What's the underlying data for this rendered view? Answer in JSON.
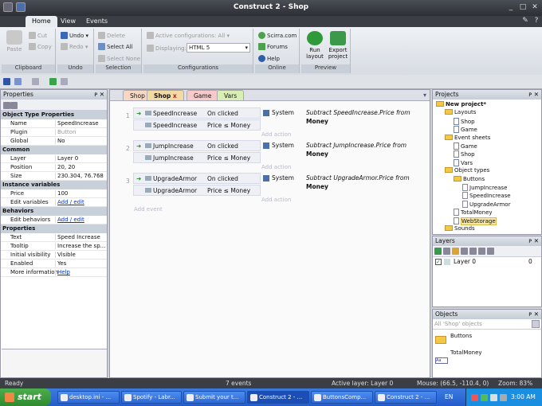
{
  "window": {
    "title": "Construct 2 - Shop"
  },
  "ribbon_tabs": [
    "Home",
    "View",
    "Events"
  ],
  "ribbon": {
    "clipboard": {
      "paste": "Paste",
      "cut": "Cut",
      "copy": "Copy",
      "group": "Clipboard"
    },
    "undo": {
      "undo": "Undo",
      "redo": "Redo",
      "group": "Undo"
    },
    "selection": {
      "delete": "Delete",
      "select_all": "Select All",
      "select_none": "Select None",
      "group": "Selection"
    },
    "configurations": {
      "active": "Active configurations: All",
      "displaying_label": "Displaying:",
      "displaying_value": "HTML 5",
      "group": "Configurations"
    },
    "online": {
      "scirra": "Scirra.com",
      "forums": "Forums",
      "help": "Help",
      "group": "Online"
    },
    "preview": {
      "run": "Run layout",
      "export": "Export project",
      "group": "Preview"
    }
  },
  "properties": {
    "title": "Properties",
    "rows": [
      {
        "type": "cat",
        "k": "Object Type Properties"
      },
      {
        "k": "Name",
        "v": "SpeedIncrease"
      },
      {
        "k": "Plugin",
        "v": "Button",
        "dis": true
      },
      {
        "k": "Global",
        "v": "No"
      },
      {
        "type": "cat",
        "k": "Common"
      },
      {
        "k": "Layer",
        "v": "Layer 0"
      },
      {
        "k": "Position",
        "v": "20, 20"
      },
      {
        "k": "Size",
        "v": "230.304, 76.768"
      },
      {
        "type": "cat",
        "k": "Instance variables"
      },
      {
        "k": "Price",
        "v": "100"
      },
      {
        "k": "Edit variables",
        "v": "Add / edit",
        "link": true
      },
      {
        "type": "cat",
        "k": "Behaviors"
      },
      {
        "k": "Edit behaviors",
        "v": "Add / edit",
        "link": true
      },
      {
        "type": "cat",
        "k": "Properties"
      },
      {
        "k": "Text",
        "v": "Speed Increase"
      },
      {
        "k": "Tooltip",
        "v": "Increase the sp..."
      },
      {
        "k": "Initial visibility",
        "v": "Visible"
      },
      {
        "k": "Enabled",
        "v": "Yes"
      },
      {
        "k": "More information",
        "v": "Help",
        "link": true
      }
    ]
  },
  "event_tabs": [
    {
      "label": "Shop"
    },
    {
      "label": "Shop",
      "active": true,
      "close": "x"
    },
    {
      "label": "Game"
    },
    {
      "label": "Vars"
    }
  ],
  "events": [
    {
      "num": "1",
      "obj": "SpeedIncrease",
      "c1": "On clicked",
      "c2": "Price ≤ Money",
      "aobj": "System",
      "a1": "Subtract SpeedIncrease.Price from",
      "a2": "Money"
    },
    {
      "num": "2",
      "obj": "JumpIncrease",
      "c1": "On clicked",
      "c2": "Price ≤ Money",
      "aobj": "System",
      "a1": "Subtract JumpIncrease.Price from",
      "a2": "Money"
    },
    {
      "num": "3",
      "obj": "UpgradeArmor",
      "c1": "On clicked",
      "c2": "Price ≤ Money",
      "aobj": "System",
      "a1": "Subtract UpgradeArmor.Price from",
      "a2": "Money"
    }
  ],
  "add_action": "Add action",
  "add_event": "Add event",
  "projects": {
    "title": "Projects",
    "tree": [
      {
        "t": "New project*",
        "d": 0,
        "i": "fold",
        "b": true
      },
      {
        "t": "Layouts",
        "d": 1,
        "i": "fold"
      },
      {
        "t": "Shop",
        "d": 2,
        "i": "doc"
      },
      {
        "t": "Game",
        "d": 2,
        "i": "doc"
      },
      {
        "t": "Event sheets",
        "d": 1,
        "i": "fold"
      },
      {
        "t": "Game",
        "d": 2,
        "i": "doc"
      },
      {
        "t": "Shop",
        "d": 2,
        "i": "doc"
      },
      {
        "t": "Vars",
        "d": 2,
        "i": "doc"
      },
      {
        "t": "Object types",
        "d": 1,
        "i": "fold"
      },
      {
        "t": "Buttons",
        "d": 2,
        "i": "fold"
      },
      {
        "t": "JumpIncrease",
        "d": 3,
        "i": "btn"
      },
      {
        "t": "SpeedIncrease",
        "d": 3,
        "i": "btn"
      },
      {
        "t": "UpgradeArmor",
        "d": 3,
        "i": "btn"
      },
      {
        "t": "TotalMoney",
        "d": 2,
        "i": "txt"
      },
      {
        "t": "WebStorage",
        "d": 2,
        "i": "ws",
        "sel": true
      },
      {
        "t": "Sounds",
        "d": 1,
        "i": "fold"
      }
    ]
  },
  "layers": {
    "title": "Layers",
    "name": "Layer 0",
    "num": "0"
  },
  "objects": {
    "title": "Objects",
    "filter": "All 'Shop' objects",
    "items": [
      "Buttons",
      "TotalMoney"
    ]
  },
  "status": {
    "ready": "Ready",
    "events": "7 events",
    "layer": "Active layer: Layer 0",
    "mouse": "Mouse: (66.5, -110.4, 0)",
    "zoom": "Zoom: 83%"
  },
  "taskbar": {
    "start": "start",
    "items": [
      "desktop.ini - ...",
      "Spotify - Labr...",
      "Submit your t...",
      "Construct 2 - ...",
      "ButtonsComp...",
      "Construct 2 - ..."
    ],
    "lang": "EN",
    "clock": "3:00 AM"
  }
}
